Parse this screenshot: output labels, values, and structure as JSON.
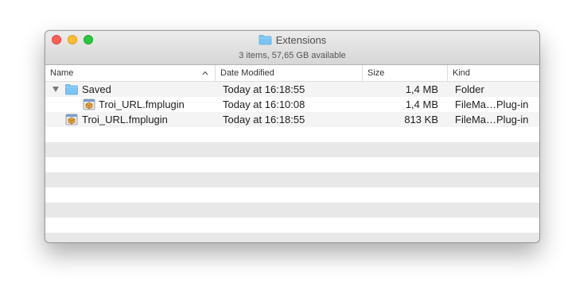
{
  "window": {
    "title": "Extensions",
    "status": "3 items, 57,65 GB available"
  },
  "columns": {
    "name": "Name",
    "date": "Date Modified",
    "size": "Size",
    "kind": "Kind"
  },
  "rows": [
    {
      "name": "Saved",
      "date": "Today at 16:18:55",
      "size": "1,4 MB",
      "kind": "Folder",
      "icon": "folder-icon",
      "expanded": true
    },
    {
      "name": "Troi_URL.fmplugin",
      "date": "Today at 16:10:08",
      "size": "1,4 MB",
      "kind": "FileMa…Plug-in",
      "icon": "plugin-icon",
      "indent": 1
    },
    {
      "name": "Troi_URL.fmplugin",
      "date": "Today at 16:18:55",
      "size": "813 KB",
      "kind": "FileMa…Plug-in",
      "icon": "plugin-icon"
    }
  ],
  "colors": {
    "close": "#fe5f57",
    "minimize": "#febc2e",
    "zoom": "#28c840",
    "folder": "#7cc4f5"
  }
}
